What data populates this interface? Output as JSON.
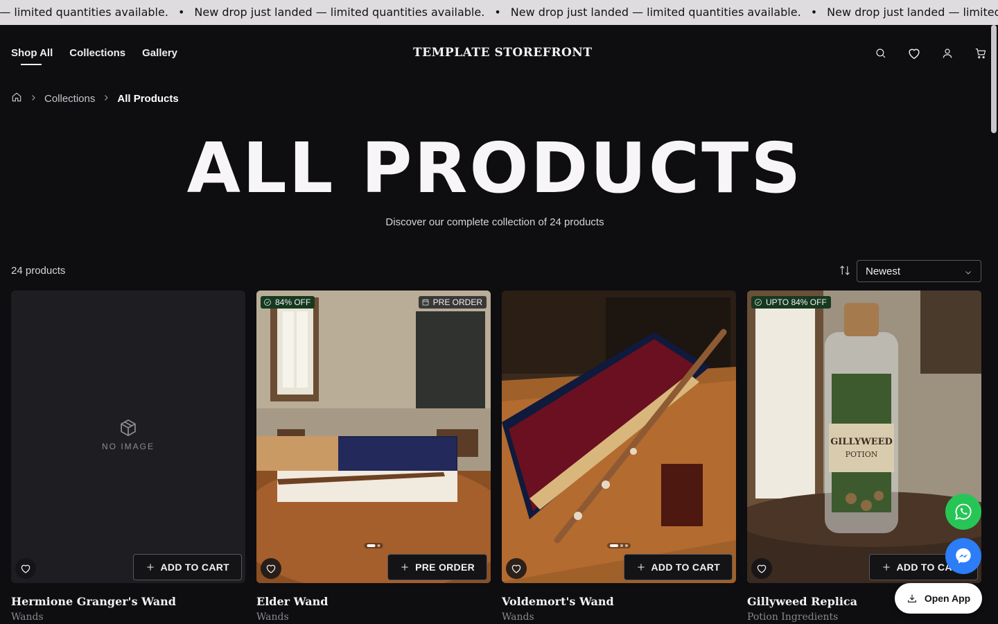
{
  "announcement": {
    "message": "New drop just landed — limited quantities available.",
    "separator": "•"
  },
  "header": {
    "nav": [
      {
        "label": "Shop All",
        "active": true
      },
      {
        "label": "Collections",
        "active": false
      },
      {
        "label": "Gallery",
        "active": false
      }
    ],
    "brand": "TEMPLATE STOREFRONT",
    "icons": [
      "search-icon",
      "heart-icon",
      "user-icon",
      "cart-icon"
    ]
  },
  "breadcrumb": {
    "items": [
      "Collections",
      "All Products"
    ]
  },
  "hero": {
    "title": "ALL PRODUCTS",
    "subtitle": "Discover our complete collection of 24 products"
  },
  "toolbar": {
    "count": "24 products",
    "sort_value": "Newest"
  },
  "products": [
    {
      "name": "Hermione Granger's Wand",
      "category": "Wands",
      "image": "none",
      "no_image_label": "NO IMAGE",
      "badge": "",
      "badge2": "",
      "button": "ADD TO CART"
    },
    {
      "name": "Elder Wand",
      "category": "Wands",
      "image": "wand-box",
      "badge": "84% OFF",
      "badge2": "PRE ORDER",
      "button": "PRE ORDER"
    },
    {
      "name": "Voldemort's Wand",
      "category": "Wands",
      "image": "wand-case",
      "badge": "",
      "badge2": "",
      "button": "ADD TO CART"
    },
    {
      "name": "Gillyweed Replica",
      "category": "Potion Ingredients",
      "image": "potion-jar",
      "badge": "UPTO 84% OFF",
      "badge2": "",
      "button": "ADD TO CART",
      "jar_label_1": "GILLYWEED",
      "jar_label_2": "POTION"
    }
  ],
  "floating": {
    "open_app": "Open App"
  },
  "colors": {
    "background": "#0e0d10",
    "badge_green": "#16391f",
    "whatsapp": "#27c556",
    "messenger": "#2c7df7"
  }
}
